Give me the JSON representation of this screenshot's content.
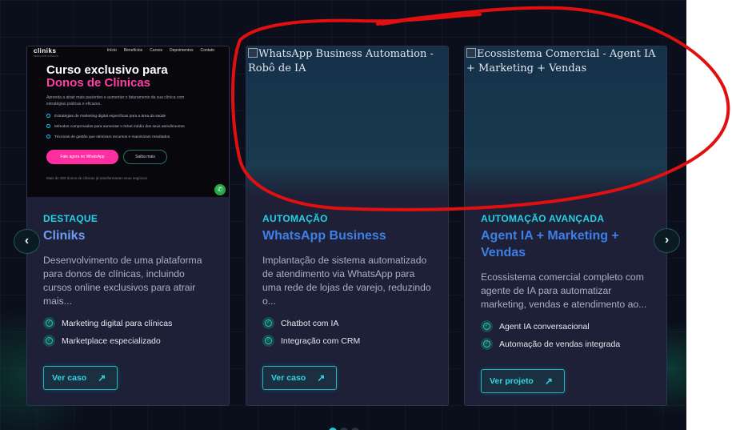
{
  "carousel": {
    "prev_icon": "chevron-left-icon",
    "next_icon": "chevron-right-icon",
    "prev_glyph": "‹",
    "next_glyph": "›",
    "slide_count": 3,
    "active_slide": 1
  },
  "cards": [
    {
      "preview": {
        "logo": "cliniks",
        "logo_sub": "FEITO POR CLÍNICAS",
        "menu": [
          "Início",
          "Benefícios",
          "Cursos",
          "Depoimentos",
          "Contato"
        ],
        "headline": "Curso exclusivo para",
        "headline_accent": "Donos de Clínicas",
        "description": "Aprenda a atrair mais pacientes e aumentar o faturamento da sua clínica com estratégias práticas e eficazes.",
        "list": [
          "Estratégias de marketing digital específicas para a área da saúde",
          "Métodos comprovados para aumentar o ticket médio dos seus atendimentos",
          "Técnicas de gestão que otimizam recursos e maximizam resultados"
        ],
        "primary_button": "Fale agora no WhatsApp",
        "secondary_button": "Saiba mais",
        "note": "Mais de 300 donos de clínicas já transformaram seus negócios"
      },
      "tag": "DESTAQUE",
      "title": "Cliniks",
      "description": "Desenvolvimento de uma plataforma para donos de clínicas, incluindo cursos online exclusivos para atrair mais...",
      "features": [
        "Marketing digital para clínicas",
        "Marketplace especializado"
      ],
      "button": "Ver caso"
    },
    {
      "image_alt": "WhatsApp Business Automation - Robô de IA",
      "tag": "AUTOMAÇÃO",
      "title": "WhatsApp Business",
      "description": "Implantação de sistema automatizado de atendimento via WhatsApp para uma rede de lojas de varejo, reduzindo o...",
      "features": [
        "Chatbot com IA",
        "Integração com CRM"
      ],
      "button": "Ver caso"
    },
    {
      "image_alt": "Ecossistema Comercial - Agent IA + Marketing + Vendas",
      "tag": "AUTOMAÇÃO AVANÇADA",
      "title": "Agent IA + Marketing + Vendas",
      "description": "Ecossistema comercial completo com agente de IA para automatizar marketing, vendas e atendimento ao...",
      "features": [
        "Agent IA conversacional",
        "Automação de vendas integrada"
      ],
      "button": "Ver projeto"
    }
  ],
  "colors": {
    "background": "#0b0e1b",
    "card": "#1d2036",
    "accent_cyan": "#22d3e6",
    "title_blue": "#3f7fe8",
    "pink": "#ff2ea0",
    "annotation_red": "#e01010"
  }
}
